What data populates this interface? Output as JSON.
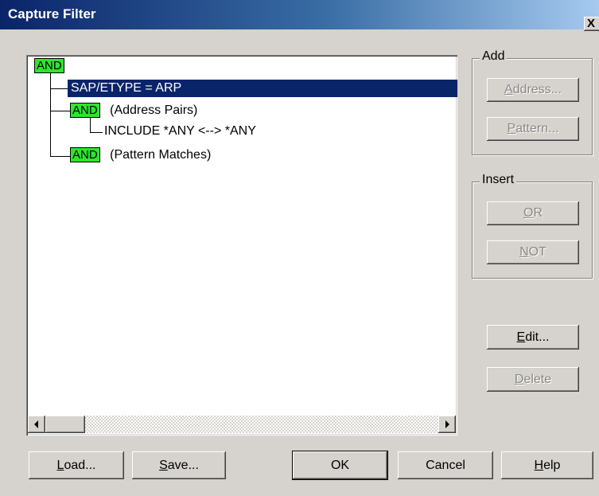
{
  "window": {
    "title": "Capture Filter",
    "close_glyph": "X"
  },
  "tree": {
    "root": "AND",
    "children": [
      {
        "label": "SAP/ETYPE = ARP",
        "selected": true
      },
      {
        "badge": "AND",
        "label": "(Address Pairs)",
        "children": [
          {
            "label": "INCLUDE *ANY <--> *ANY"
          }
        ]
      },
      {
        "badge": "AND",
        "label": "(Pattern Matches)"
      }
    ]
  },
  "add_group": {
    "label": "Add",
    "address_button": {
      "mnemonic": "A",
      "rest": "ddress...",
      "enabled": false
    },
    "pattern_button": {
      "mnemonic": "P",
      "rest": "attern...",
      "enabled": false
    }
  },
  "insert_group": {
    "label": "Insert",
    "or_button": {
      "mnemonic": "O",
      "rest": "R",
      "enabled": false
    },
    "not_button": {
      "mnemonic": "N",
      "rest": "OT",
      "enabled": false
    }
  },
  "edit_button": {
    "mnemonic": "E",
    "rest": "dit...",
    "enabled": true
  },
  "delete_button": {
    "mnemonic": "D",
    "rest": "elete",
    "enabled": false
  },
  "footer": {
    "load_button": {
      "mnemonic": "L",
      "rest": "oad..."
    },
    "save_button": {
      "mnemonic": "S",
      "rest": "ave..."
    },
    "ok_button": {
      "label": "OK"
    },
    "cancel_button": {
      "label": "Cancel"
    },
    "help_button": {
      "mnemonic": "H",
      "rest": "elp"
    }
  },
  "colors": {
    "titlebar_start": "#0a246a",
    "selection": "#0a246a",
    "badge_green": "#2ee52e",
    "dialog_face": "#d6d3ce"
  }
}
